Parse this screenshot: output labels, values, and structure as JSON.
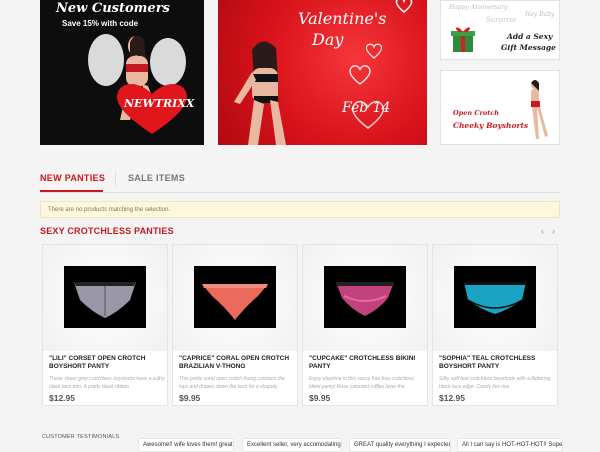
{
  "banners": {
    "new_customers": {
      "line1": "New Customers",
      "line2": "Save 15% with code",
      "code": "NEWTRIXX"
    },
    "valentines": {
      "title_line1": "Valentine's",
      "title_line2": "Day",
      "date": "Feb 14"
    },
    "anniversary": {
      "line1": "Happy Anniversary",
      "line2": "Surprise",
      "line3": "Hey Baby",
      "cta1": "Add a Sexy",
      "cta2": "Gift Message"
    },
    "cheeky": {
      "line1": "Open Crotch",
      "line2": "Cheeky Boyshorts"
    }
  },
  "tabs": [
    {
      "label": "NEW PANTIES",
      "active": true
    },
    {
      "label": "SALE ITEMS",
      "active": false
    }
  ],
  "notice": "There are no products matching the selection.",
  "section": {
    "title": "SEXY CROTCHLESS PANTIES",
    "prev_glyph": "‹",
    "next_glyph": "›"
  },
  "products": [
    {
      "name": "\"LILI\" CORSET OPEN CROTCH BOYSHORT PANTY",
      "desc": "These sheer grey crotchless boyshorts have a sultry black lace trim. A pretty black ribbon",
      "price": "$12.95",
      "color": "#9a98a6"
    },
    {
      "name": "\"CAPRICE\" CORAL OPEN CROTCH BRAZILIAN V-THONG",
      "desc": "This pretty coral open crotch thong contours the hips and drapes down the bum for a shapely",
      "price": "$9.95",
      "color": "#ec6a5c"
    },
    {
      "name": "\"CUPCAKE\" CROTCHLESS BIKINI PANTY",
      "desc": "Enjoy playtime in this sassy frou frou crotchless bikini panty! Rose coloured ruffles layer the",
      "price": "$9.95",
      "color": "#c2427e"
    },
    {
      "name": "\"SOPHIA\" TEAL CROTCHLESS BOYSHORT PANTY",
      "desc": "Silky soft teal crotchless boyshorts with a flattering black lace edge. Comfy low rise",
      "price": "$12.95",
      "color": "#19a3c4"
    }
  ],
  "testimonials": {
    "label": "CUSTOMER TESTIMONIALS",
    "items": [
      "Awesome!! wife loves them! great",
      "Excellent seller, very accomodating.",
      "GREAT quality everything I expected",
      "All I can say is HOT-HOT-HOT!! Super"
    ]
  },
  "colors": {
    "accent": "#c8191e",
    "banner_red": "#d8121a"
  }
}
